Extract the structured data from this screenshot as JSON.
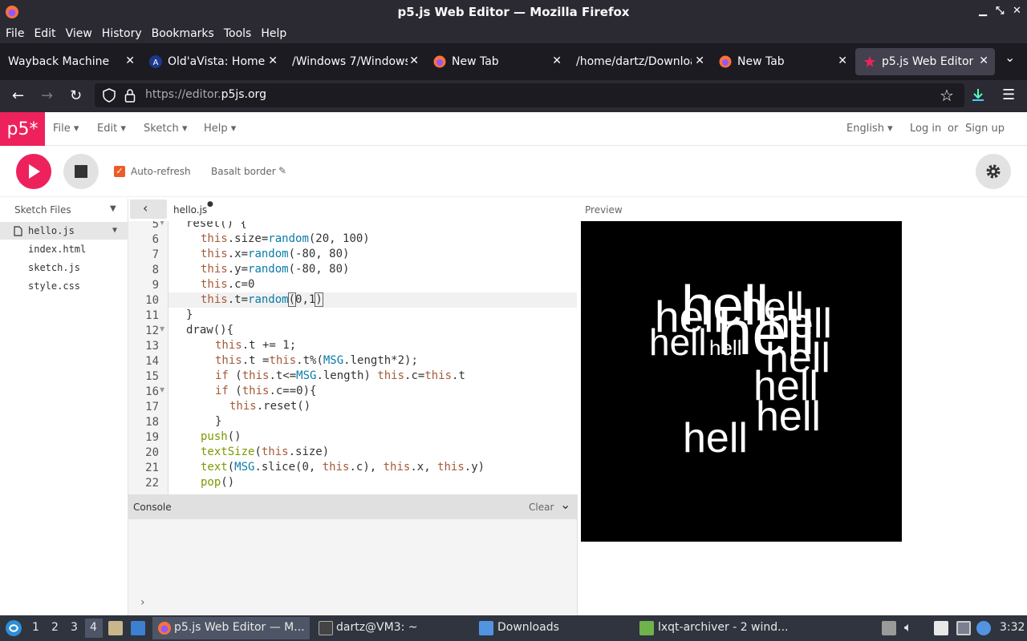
{
  "window": {
    "title": "p5.js Web Editor — Mozilla Firefox"
  },
  "menubar": [
    "File",
    "Edit",
    "View",
    "History",
    "Bookmarks",
    "Tools",
    "Help"
  ],
  "tabs": [
    {
      "label": "Wayback Machine",
      "icon": "page-icon"
    },
    {
      "label": "Old'aVista: Home",
      "icon": "oldavista-icon"
    },
    {
      "label": "/Windows 7/Windows",
      "icon": ""
    },
    {
      "label": "New Tab",
      "icon": "firefox-icon"
    },
    {
      "label": "/home/dartz/Downloa",
      "icon": ""
    },
    {
      "label": "New Tab",
      "icon": "firefox-icon"
    },
    {
      "label": "p5.js Web Editor",
      "icon": "p5-star-icon",
      "active": true
    }
  ],
  "url": {
    "prefix": "https://editor.",
    "domain": "p5js.org"
  },
  "p5": {
    "logo": "p5*",
    "menus": [
      "File",
      "Edit",
      "Sketch",
      "Help"
    ],
    "language": "English",
    "login": "Log in",
    "or": "or",
    "signup": "Sign up",
    "autorefresh": "Auto-refresh",
    "sketch_name": "Basalt border",
    "sketch_files": "Sketch Files",
    "files": [
      "hello.js",
      "index.html",
      "sketch.js",
      "style.css"
    ],
    "active_file": "hello.js",
    "preview": "Preview",
    "console": "Console",
    "clear": "Clear",
    "console_prompt": "›"
  },
  "code": {
    "line_numbers": [
      "5",
      "6",
      "7",
      "8",
      "9",
      "10",
      "11",
      "12",
      "13",
      "14",
      "15",
      "16",
      "17",
      "18",
      "19",
      "20",
      "21",
      "22"
    ]
  },
  "canvas_words": [
    "hell",
    "hell",
    "hell",
    "hell",
    "hell",
    "hell",
    "hell",
    "hell",
    "hell",
    "hell",
    "hell"
  ],
  "taskbar": {
    "workspaces": [
      "1",
      "2",
      "3",
      "4"
    ],
    "items": [
      "p5.js Web Editor — M...",
      "dartz@VM3: ~",
      "Downloads",
      "lxqt-archiver - 2 wind..."
    ],
    "clock": "3:32"
  },
  "colors": {
    "accent": "#ed225d",
    "chrome": "#2b2a33",
    "canvas": "#000000"
  }
}
